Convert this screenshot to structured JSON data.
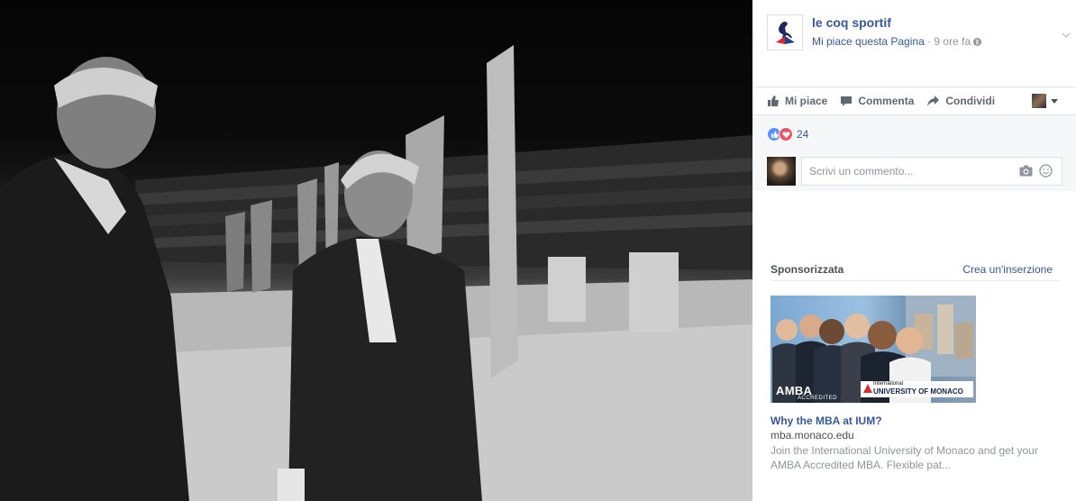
{
  "post": {
    "page_name": "le coq sportif",
    "like_page": "Mi piace questa Pagina",
    "separator": " · ",
    "time": "9 ore fa",
    "privacy_icon": "globe-icon"
  },
  "actions": {
    "like": "Mi piace",
    "comment": "Commenta",
    "share": "Condividi"
  },
  "engagement": {
    "reaction_count": "24",
    "comment_placeholder": "Scrivi un commento..."
  },
  "sponsored": {
    "title": "Sponsorizzata",
    "create_ad": "Crea un'inserzione",
    "ad": {
      "amba_logo": "AMBA",
      "amba_subtext": "ACCREDITED",
      "school_line1": "International",
      "school_line2": "UNIVERSITY OF MONACO",
      "headline": "Why the MBA at IUM?",
      "domain": "mba.monaco.edu",
      "description": "Join the International University of Monaco and get your AMBA Accredited MBA. Flexible pat..."
    }
  },
  "colors": {
    "link": "#365899",
    "like_reaction": "#5890ff",
    "love_reaction": "#f25268"
  }
}
